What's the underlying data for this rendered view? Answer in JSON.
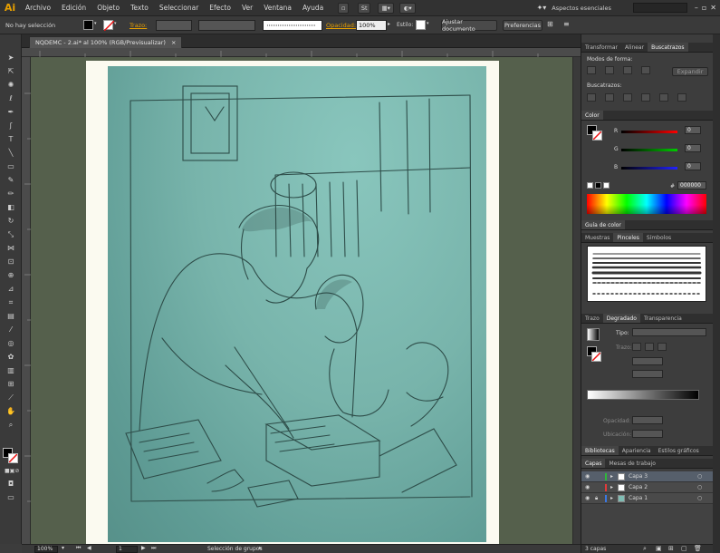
{
  "app": {
    "logo": "Ai"
  },
  "menu": [
    "Archivo",
    "Edición",
    "Objeto",
    "Texto",
    "Seleccionar",
    "Efecto",
    "Ver",
    "Ventana",
    "Ayuda"
  ],
  "menubar_right": {
    "bridge_label": "St",
    "workspace": "Aspectos esenciales"
  },
  "control_bar": {
    "selection_status": "No hay selección",
    "stroke_label": "Trazo:",
    "opacity_label": "Opacidad:",
    "opacity_value": "100%",
    "style_label": "Estilo:",
    "fit_document_button": "Ajustar documento",
    "preferences_button": "Preferencias"
  },
  "document": {
    "tab_title": "NQDEMC - 2.ai* al 100% (RGB/Previsualizar)",
    "close_glyph": "×"
  },
  "status_bar": {
    "zoom": "100%",
    "artboard": "1",
    "selection_tool": "Selección de grupos"
  },
  "panels": {
    "transform_tabs": [
      "Transformar",
      "Alinear",
      "Buscatrazos"
    ],
    "shape_modes_label": "Modos de forma:",
    "expand_button": "Expandir",
    "pathfinders_label": "Buscatrazos:",
    "color_tab": "Color",
    "channels": [
      {
        "name": "R",
        "value": "0"
      },
      {
        "name": "G",
        "value": "0"
      },
      {
        "name": "B",
        "value": "0"
      }
    ],
    "hex_value": "000000",
    "hex_label": "#",
    "color_guide_tab": "Guía de color",
    "brush_tabs": [
      "Muestras",
      "Pinceles",
      "Símbolos"
    ],
    "gradient_tabs": [
      "Trazo",
      "Degradado",
      "Transparencia"
    ],
    "gradient_type_label": "Tipo:",
    "gradient_stroke_label": "Trazo:",
    "opacity_label": "Opacidad:",
    "location_label": "Ubicación:",
    "library_tabs": [
      "Bibliotecas",
      "Apariencia",
      "Estilos gráficos"
    ],
    "layer_tabs": [
      "Capas",
      "Mesas de trabajo"
    ],
    "layers": [
      {
        "name": "Capa 3",
        "color": "#2fb83a",
        "selected": true
      },
      {
        "name": "Capa 2",
        "color": "#e23a3a",
        "selected": false
      },
      {
        "name": "Capa 1",
        "color": "#3a78e2",
        "selected": false
      }
    ],
    "layers_count": "3 capas"
  },
  "colors": {
    "accent": "#e8a000",
    "canvas": "#55604c",
    "fill": "#000000"
  }
}
